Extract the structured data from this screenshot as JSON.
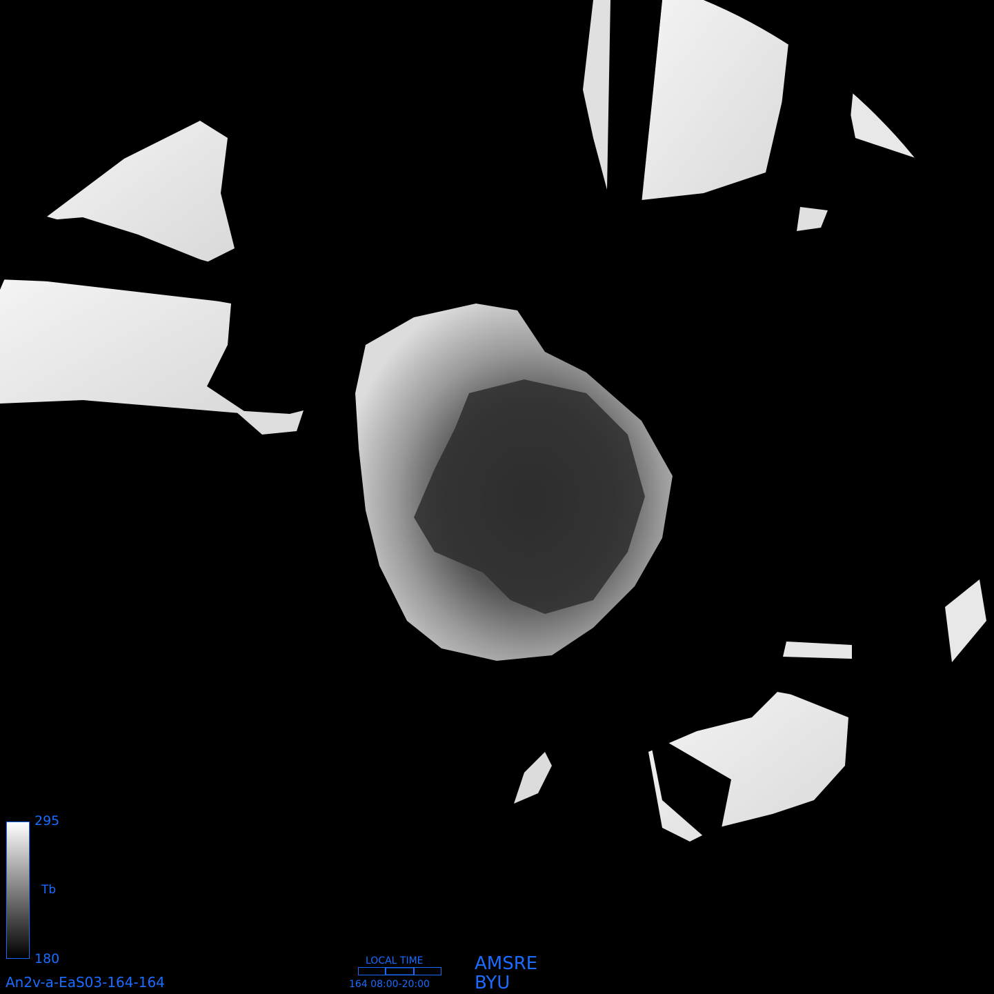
{
  "colorbar": {
    "max_label": "295",
    "min_label": "180",
    "variable_label": "Tb",
    "gradient_top": "#ffffff",
    "gradient_bottom": "#000000",
    "border_color": "#1a6cff"
  },
  "product_id": "An2v-a-EaS03-164-164",
  "local_time": {
    "title": "LOCAL TIME",
    "range": "164 08:00-20:00",
    "shown_window_fraction": [
      0.33,
      0.67
    ]
  },
  "credits": {
    "sensor": "AMSRE",
    "organization": "BYU"
  },
  "colors": {
    "text": "#1a6cff",
    "background": "#000000"
  }
}
